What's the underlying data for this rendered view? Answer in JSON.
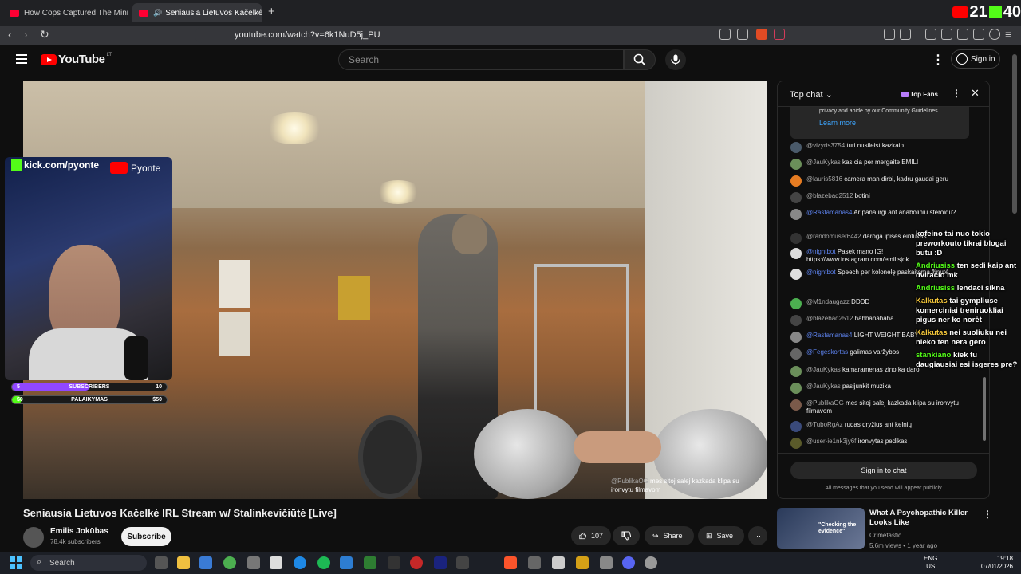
{
  "browser": {
    "tabs": [
      {
        "label": "How Cops Captured The Minnesota M",
        "active": false
      },
      {
        "label": "Seniausia Lietuvos Kačelkė IRL",
        "active": true
      }
    ],
    "url": "youtube.com/watch?v=6k1NuD5j_PU",
    "counter_youtube": "21",
    "counter_kick": "40"
  },
  "header": {
    "logo_text": "YouTube",
    "country": "LT",
    "search_placeholder": "Search",
    "signin_label": "Sign in"
  },
  "overlay": {
    "kick_handle": "kick.com/pyonte",
    "yt_handle": "Pyonte",
    "goals": [
      {
        "left": "5",
        "label": "SUBSCRIBERS",
        "right": "10",
        "color": "#9147ff",
        "progress": 0.5
      },
      {
        "left": "$0",
        "label": "PALAIKYMAS",
        "right": "$50",
        "color": "#53fc18",
        "progress": 0.05
      }
    ],
    "caption_author": "@PublikaOG",
    "caption_text": "mes sitoj salej kazkada klipa su ironvytu filmavom"
  },
  "video": {
    "title": "Seniausia Lietuvos Kačelkė IRL Stream w/ Stalinkevičiūtė [Live]",
    "channel": "Emilis Jokūbas",
    "subscribers": "78.4k subscribers",
    "subscribe_label": "Subscribe",
    "likes": "107",
    "share_label": "Share",
    "save_label": "Save"
  },
  "chat": {
    "header": "Top chat",
    "top_fans_label": "Top Fans",
    "notice_text": "privacy and abide by our Community Guidelines.",
    "learn_more": "Learn more",
    "messages": [
      {
        "author": "@vizyris3754",
        "text": "turi nusileist kazkaip",
        "mod": false,
        "color": "#4a5a6a"
      },
      {
        "author": "@JauKykas",
        "text": "kas cia per mergaite EMILI",
        "mod": false,
        "color": "#6b8f5a"
      },
      {
        "author": "@lauris5816",
        "text": "camera man dirbi, kadru gaudai geru",
        "mod": false,
        "color": "#e67c22"
      },
      {
        "author": "@blazebad2512",
        "text": "botini",
        "mod": false,
        "color": "#444"
      },
      {
        "author": "@Rastamanas4",
        "text": "Ar pana irgi ant anaboliniu steroidu?",
        "mod": true,
        "color": "#888"
      },
      {
        "author": "@randomuser6442",
        "text": "daroga ipises eintukas",
        "mod": false,
        "color": "#333"
      },
      {
        "author": "@nightbot",
        "text": "Pasek mano IG! https://www.instagram.com/emilisjok",
        "mod": true,
        "color": "#ddd"
      },
      {
        "author": "@nightbot",
        "text": "Speech per kolonėlę paskaitoma žinutė.",
        "mod": true,
        "color": "#ddd"
      },
      {
        "author": "@M1ndaugazz",
        "text": "DDDD",
        "mod": false,
        "color": "#4caf50"
      },
      {
        "author": "@blazebad2512",
        "text": "hahhahahaha",
        "mod": false,
        "color": "#444"
      },
      {
        "author": "@Rastamanas4",
        "text": "LIGHT WEIGHT BABY",
        "mod": true,
        "color": "#888"
      },
      {
        "author": "@Fegeskortas",
        "text": "galimas varžybos",
        "mod": true,
        "color": "#666"
      },
      {
        "author": "@JauKykas",
        "text": "kamaramenas zino ka daro",
        "mod": false,
        "color": "#6b8f5a"
      },
      {
        "author": "@JauKykas",
        "text": "pasijunkit muzika",
        "mod": false,
        "color": "#6b8f5a"
      },
      {
        "author": "@PublikaOG",
        "text": "mes sitoj salej kazkada klipa su ironvytu filmavom",
        "mod": false,
        "color": "#7a5a4a"
      },
      {
        "author": "@TuboRgAz",
        "text": "rudas dryžius ant kelnių",
        "mod": false,
        "color": "#3a4a7a"
      },
      {
        "author": "@user-ie1nk3jy6f",
        "text": "ironvytas pedikas",
        "mod": false,
        "color": "#5a5a2a"
      }
    ],
    "signin_label": "Sign in to chat",
    "public_note": "All messages that you send will appear publicly"
  },
  "kick_chat": [
    {
      "user": "",
      "text": "kofeino tai nuo tokio preworkouto tikrai blogai butu :D"
    },
    {
      "user": "Andriusiss",
      "text": "ten sedi kaip ant dviracio mk"
    },
    {
      "user": "Andriusiss",
      "text": "lendaci sikna"
    },
    {
      "user": "Kalkutas",
      "text": "tai gympliuse komerciniai treniruokliai pigus ner ko norėt"
    },
    {
      "user": "Kalkutas",
      "text": "nei suoliuku nei nieko ten nera gero"
    },
    {
      "user": "stankiano",
      "text": "kiek tu daugiausiai esi isgeres pre?"
    }
  ],
  "recommended": {
    "title": "What A Psychopathic Killer Looks Like",
    "channel": "Crimetastic",
    "meta": "5.6m views • 1 year ago",
    "thumb_text": "\"Checking the evidence\""
  },
  "taskbar": {
    "search_placeholder": "Search",
    "lang_top": "ENG",
    "lang_bottom": "US",
    "time": "19:18",
    "date": "07/01/2026"
  }
}
